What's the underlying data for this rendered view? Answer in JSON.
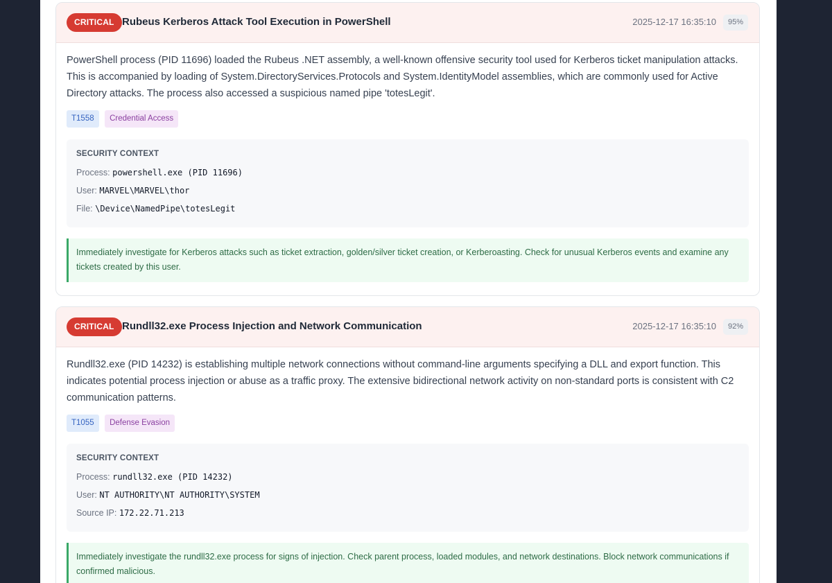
{
  "alerts": [
    {
      "severity": "CRITICAL",
      "title": "Rubeus Kerberos Attack Tool Execution in PowerShell",
      "timestamp": "2025-12-17 16:35:10",
      "confidence": "95%",
      "description": "PowerShell process (PID 11696) loaded the Rubeus .NET assembly, a well-known offensive security tool used for Kerberos ticket manipulation attacks. This is accompanied by loading of System.DirectoryServices.Protocols and System.IdentityModel assemblies, which are commonly used for Active Directory attacks. The process also accessed a suspicious named pipe 'totesLegit'.",
      "technique": "T1558",
      "tactic": "Credential Access",
      "context_heading": "SECURITY CONTEXT",
      "context": [
        {
          "label": "Process:",
          "value": "powershell.exe (PID 11696)"
        },
        {
          "label": "User:",
          "value": "MARVEL\\MARVEL\\thor"
        },
        {
          "label": "File:",
          "value": "\\Device\\NamedPipe\\totesLegit"
        }
      ],
      "recommendation": "Immediately investigate for Kerberos attacks such as ticket extraction, golden/silver ticket creation, or Kerberoasting. Check for unusual Kerberos events and examine any tickets created by this user."
    },
    {
      "severity": "CRITICAL",
      "title": "Rundll32.exe Process Injection and Network Communication",
      "timestamp": "2025-12-17 16:35:10",
      "confidence": "92%",
      "description": "Rundll32.exe (PID 14232) is establishing multiple network connections without command-line arguments specifying a DLL and export function. This indicates potential process injection or abuse as a traffic proxy. The extensive bidirectional network activity on non-standard ports is consistent with C2 communication patterns.",
      "technique": "T1055",
      "tactic": "Defense Evasion",
      "context_heading": "SECURITY CONTEXT",
      "context": [
        {
          "label": "Process:",
          "value": "rundll32.exe (PID 14232)"
        },
        {
          "label": "User:",
          "value": "NT AUTHORITY\\NT AUTHORITY\\SYSTEM"
        },
        {
          "label": "Source IP:",
          "value": "172.22.71.213"
        }
      ],
      "recommendation": "Immediately investigate the rundll32.exe process for signs of injection. Check parent process, loaded modules, and network destinations. Block network communications if confirmed malicious."
    }
  ]
}
